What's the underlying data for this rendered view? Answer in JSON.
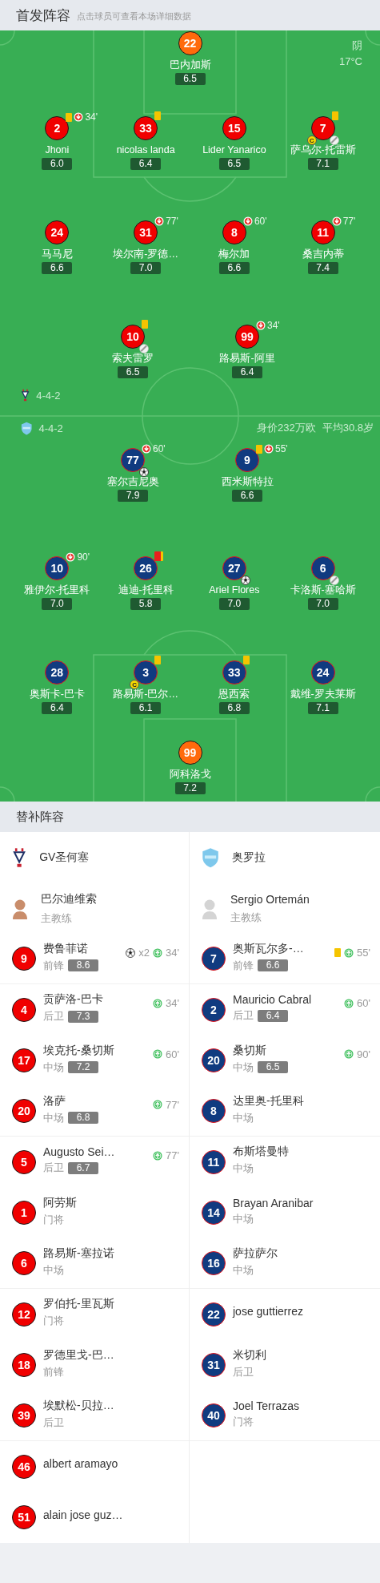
{
  "header": {
    "title": "首发阵容",
    "subtitle": "点击球员可查看本场详细数据"
  },
  "weather": {
    "condition": "阴",
    "temperature": "17°C"
  },
  "home": {
    "formation": "4-4-2",
    "lines": [
      {
        "kind": "goalkeeper",
        "players": [
          {
            "number": "22",
            "name": "巴内加斯",
            "rating": "6.5"
          }
        ]
      },
      {
        "kind": "outfield",
        "players": [
          {
            "number": "2",
            "name": "Jhoni",
            "rating": "6.0",
            "events": [
              {
                "kind": "yellow"
              },
              {
                "kind": "sub_out",
                "minute": "34'"
              }
            ]
          },
          {
            "number": "33",
            "name": "nicolas landa",
            "rating": "6.4",
            "events": [
              {
                "kind": "yellow"
              }
            ]
          },
          {
            "number": "15",
            "name": "Lider Yanarico",
            "rating": "6.5"
          },
          {
            "number": "7",
            "name": "萨乌尔-托雷斯",
            "rating": "7.1",
            "events": [
              {
                "kind": "yellow"
              },
              {
                "kind": "captain",
                "label": "C"
              },
              {
                "kind": "assist"
              }
            ]
          }
        ]
      },
      {
        "kind": "outfield",
        "players": [
          {
            "number": "24",
            "name": "马马尼",
            "rating": "6.6"
          },
          {
            "number": "31",
            "name": "埃尔南-罗德…",
            "rating": "7.0",
            "events": [
              {
                "kind": "sub_out",
                "minute": "77'"
              }
            ]
          },
          {
            "number": "8",
            "name": "梅尔加",
            "rating": "6.6",
            "events": [
              {
                "kind": "sub_out",
                "minute": "60'"
              }
            ]
          },
          {
            "number": "11",
            "name": "桑吉内蒂",
            "rating": "7.4",
            "events": [
              {
                "kind": "sub_out",
                "minute": "77'"
              }
            ]
          }
        ]
      },
      {
        "kind": "outfield",
        "players": [
          {
            "number": "10",
            "name": "索夫雷罗",
            "rating": "6.5",
            "events": [
              {
                "kind": "yellow"
              },
              {
                "kind": "assist"
              }
            ]
          },
          {
            "number": "99",
            "name": "路易斯-阿里",
            "rating": "6.4",
            "events": [
              {
                "kind": "sub_out",
                "minute": "34'"
              }
            ]
          }
        ]
      }
    ]
  },
  "away": {
    "formation": "4-4-2",
    "market_value": "身价232万欧",
    "average_age": "平均30.8岁",
    "lines": [
      {
        "kind": "outfield",
        "players": [
          {
            "number": "77",
            "name": "塞尔吉尼奥",
            "rating": "7.9",
            "events": [
              {
                "kind": "sub_out",
                "minute": "60'"
              },
              {
                "kind": "goal"
              }
            ]
          },
          {
            "number": "9",
            "name": "西米斯特拉",
            "rating": "6.6",
            "events": [
              {
                "kind": "yellow"
              },
              {
                "kind": "sub_out",
                "minute": "55'"
              }
            ]
          }
        ]
      },
      {
        "kind": "outfield",
        "players": [
          {
            "number": "10",
            "name": "雅伊尔-托里科",
            "rating": "7.0",
            "events": [
              {
                "kind": "sub_out",
                "minute": "90'"
              }
            ]
          },
          {
            "number": "26",
            "name": "迪迪-托里科",
            "rating": "5.8",
            "events": [
              {
                "kind": "red"
              }
            ]
          },
          {
            "number": "27",
            "name": "Ariel Flores",
            "rating": "7.0",
            "events": [
              {
                "kind": "goal"
              }
            ]
          },
          {
            "number": "6",
            "name": "卡洛斯-塞哈斯",
            "rating": "7.0",
            "events": [
              {
                "kind": "assist"
              }
            ]
          }
        ]
      },
      {
        "kind": "outfield",
        "players": [
          {
            "number": "28",
            "name": "奥斯卡-巴卡",
            "rating": "6.4"
          },
          {
            "number": "3",
            "name": "路易斯-巴尔…",
            "rating": "6.1",
            "events": [
              {
                "kind": "yellow"
              },
              {
                "kind": "captain",
                "label": "C"
              }
            ]
          },
          {
            "number": "33",
            "name": "恩西索",
            "rating": "6.8",
            "events": [
              {
                "kind": "yellow"
              }
            ]
          },
          {
            "number": "24",
            "name": "戴维-罗夫莱斯",
            "rating": "7.1"
          }
        ]
      },
      {
        "kind": "goalkeeper",
        "players": [
          {
            "number": "99",
            "name": "阿科洛戈",
            "rating": "7.2"
          }
        ]
      }
    ]
  },
  "subs": {
    "title": "替补阵容",
    "teams": [
      {
        "kind": "home",
        "team": "GV圣何塞",
        "coach": {
          "name": "巴尔迪维索",
          "role": "主教练"
        },
        "players": [
          {
            "number": "9",
            "name": "费鲁菲诺",
            "position": "前锋",
            "rating": "8.6",
            "events": [
              {
                "kind": "goal",
                "count": "x2"
              },
              {
                "kind": "sub_in",
                "minute": "34'"
              }
            ]
          },
          {
            "number": "4",
            "name": "贡萨洛-巴卡",
            "position": "后卫",
            "rating": "7.3",
            "events": [
              {
                "kind": "sub_in",
                "minute": "34'"
              }
            ]
          },
          {
            "number": "17",
            "name": "埃克托-桑切斯",
            "position": "中场",
            "rating": "7.2",
            "events": [
              {
                "kind": "sub_in",
                "minute": "60'"
              }
            ]
          },
          {
            "number": "20",
            "name": "洛萨",
            "position": "中场",
            "rating": "6.8",
            "events": [
              {
                "kind": "sub_in",
                "minute": "77'"
              }
            ]
          },
          {
            "number": "5",
            "name": "Augusto Sei…",
            "position": "后卫",
            "rating": "6.7",
            "events": [
              {
                "kind": "sub_in",
                "minute": "77'"
              }
            ]
          },
          {
            "number": "1",
            "name": "阿劳斯",
            "position": "门将"
          },
          {
            "number": "6",
            "name": "路易斯-塞拉诺",
            "position": "中场"
          },
          {
            "number": "12",
            "name": "罗伯托-里瓦斯",
            "position": "门将"
          },
          {
            "number": "18",
            "name": "罗德里戈-巴…",
            "position": "前锋"
          },
          {
            "number": "39",
            "name": "埃默松-贝拉…",
            "position": "后卫"
          },
          {
            "number": "46",
            "name": "albert aramayo"
          },
          {
            "number": "51",
            "name": "alain jose guz…"
          }
        ]
      },
      {
        "kind": "away",
        "team": "奥罗拉",
        "coach": {
          "name": "Sergio Ortemán",
          "role": "主教练"
        },
        "players": [
          {
            "number": "7",
            "name": "奥斯瓦尔多-…",
            "position": "前锋",
            "rating": "6.6",
            "events": [
              {
                "kind": "yellow"
              },
              {
                "kind": "sub_in",
                "minute": "55'"
              }
            ]
          },
          {
            "number": "2",
            "name": "Mauricio Cabral",
            "position": "后卫",
            "rating": "6.4",
            "events": [
              {
                "kind": "sub_in",
                "minute": "60'"
              }
            ]
          },
          {
            "number": "20",
            "name": "桑切斯",
            "position": "中场",
            "rating": "6.5",
            "events": [
              {
                "kind": "sub_in",
                "minute": "90'"
              }
            ]
          },
          {
            "number": "8",
            "name": "达里奥-托里科",
            "position": "中场"
          },
          {
            "number": "11",
            "name": "布斯塔曼特",
            "position": "中场"
          },
          {
            "number": "14",
            "name": "Brayan Aranibar",
            "position": "中场"
          },
          {
            "number": "16",
            "name": "萨拉萨尔",
            "position": "中场"
          },
          {
            "number": "22",
            "name": "jose guttierrez"
          },
          {
            "number": "31",
            "name": "米切利",
            "position": "后卫"
          },
          {
            "number": "40",
            "name": "Joel Terrazas",
            "position": "门将"
          }
        ]
      }
    ]
  }
}
